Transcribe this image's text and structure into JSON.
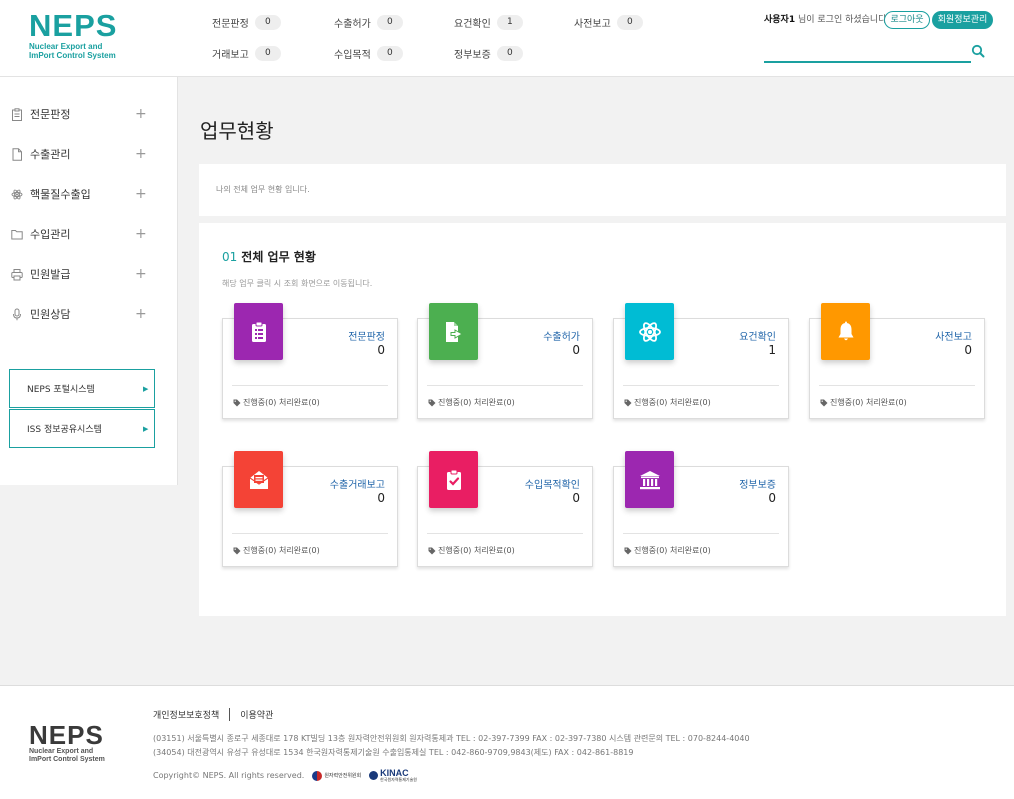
{
  "header": {
    "logo_word": "NEPS",
    "logo_sub_line1": "Nuclear Export and",
    "logo_sub_line2": "ImPort Control System",
    "counters": [
      {
        "label": "전문판정",
        "count": "0"
      },
      {
        "label": "수출허가",
        "count": "0"
      },
      {
        "label": "요건확인",
        "count": "1"
      },
      {
        "label": "사전보고",
        "count": "0"
      },
      {
        "label": "거래보고",
        "count": "0"
      },
      {
        "label": "수입목적",
        "count": "0"
      },
      {
        "label": "정부보증",
        "count": "0"
      }
    ],
    "user_name": "사용자1",
    "user_suffix": " 님이 로그인 하셨습니다.",
    "logout_label": "로그아웃",
    "member_label": "회원정보관리",
    "search_value": ""
  },
  "sidebar": {
    "items": [
      {
        "label": "전문판정",
        "icon": "clipboard-icon"
      },
      {
        "label": "수출관리",
        "icon": "document-icon"
      },
      {
        "label": "핵물질수출입",
        "icon": "atom-icon"
      },
      {
        "label": "수입관리",
        "icon": "folder-icon"
      },
      {
        "label": "민원발급",
        "icon": "printer-icon"
      },
      {
        "label": "민원상담",
        "icon": "microphone-icon"
      }
    ],
    "plus": "+",
    "portals": [
      {
        "label": "NEPS 포털시스템",
        "arrow": "▶"
      },
      {
        "label": "ISS 정보공유시스템",
        "arrow": "▶"
      }
    ]
  },
  "main": {
    "title": "업무현황",
    "description": "나의 전체 업무 현황 입니다.",
    "section_num": "01",
    "section_title": "전체 업무 현황",
    "section_desc": "해당 업무 클릭 시 조회 화면으로 이동됩니다.",
    "cards": [
      {
        "title": "전문판정",
        "count": "0",
        "status": "진행중(0) 처리완료(0)",
        "color": "#9c27b0",
        "icon": "clipboard-list-icon"
      },
      {
        "title": "수출허가",
        "count": "0",
        "status": "진행중(0) 처리완료(0)",
        "color": "#4caf50",
        "icon": "file-export-icon"
      },
      {
        "title": "요건확인",
        "count": "1",
        "status": "진행중(0) 처리완료(0)",
        "color": "#00bcd4",
        "icon": "atom-icon"
      },
      {
        "title": "사전보고",
        "count": "0",
        "status": "진행중(0) 처리완료(0)",
        "color": "#ff9800",
        "icon": "bell-icon"
      },
      {
        "title": "수출거래보고",
        "count": "0",
        "status": "진행중(0) 처리완료(0)",
        "color": "#f44336",
        "icon": "envelope-open-icon"
      },
      {
        "title": "수입목적확인",
        "count": "0",
        "status": "진행중(0) 처리완료(0)",
        "color": "#e91e63",
        "icon": "clipboard-check-icon"
      },
      {
        "title": "정부보증",
        "count": "0",
        "status": "진행중(0) 처리완료(0)",
        "color": "#9c27b0",
        "icon": "government-icon"
      }
    ]
  },
  "footer": {
    "logo_word": "NEPS",
    "logo_sub_line1": "Nuclear Export and",
    "logo_sub_line2": "ImPort Control System",
    "privacy": "개인정보보호정책",
    "terms": "이용약관",
    "address1": "(03151) 서울특별시 종로구 세종대로 178 KT빌딩 13층 원자력안전위원회 원자력통제과   TEL : 02-397-7399   FAX : 02-397-7380   시스템 관련문의 TEL : 070-8244-4040",
    "address2": "(34054) 대전광역시 유성구 유성대로 1534 한국원자력통제기술원 수출입통제실   TEL : 042-860-9709,9843(제도)   FAX : 042-861-8819",
    "copyright": "Copyright© NEPS. All rights reserved.",
    "org1": "원자력안전위원회",
    "org2": "KINAC",
    "org2_sub": "한국원자력통제기술원"
  }
}
